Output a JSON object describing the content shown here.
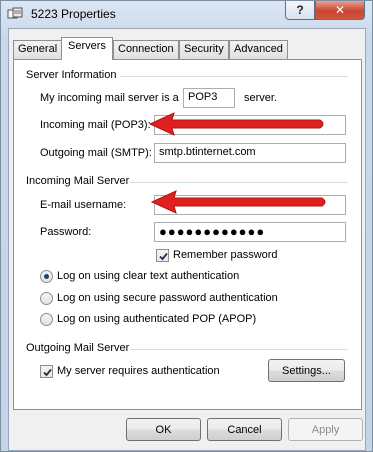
{
  "window": {
    "title": "5223 Properties",
    "help_label": "?",
    "close_label": "✕"
  },
  "tabs": [
    {
      "label": "General",
      "active": false
    },
    {
      "label": "Servers",
      "active": true
    },
    {
      "label": "Connection",
      "active": false
    },
    {
      "label": "Security",
      "active": false
    },
    {
      "label": "Advanced",
      "active": false
    }
  ],
  "server_info": {
    "group_label": "Server Information",
    "incoming_server_prefix": "My incoming mail server is a",
    "incoming_server_type": "POP3",
    "incoming_server_suffix": "server.",
    "incoming_mail_label": "Incoming mail (POP3):",
    "incoming_mail_value": "",
    "outgoing_mail_label": "Outgoing mail (SMTP):",
    "outgoing_mail_value": "smtp.btinternet.com"
  },
  "incoming_server": {
    "group_label": "Incoming Mail Server",
    "username_label": "E-mail username:",
    "username_value": "",
    "password_label": "Password:",
    "password_value": "●●●●●●●●●●●●",
    "remember_label": "Remember password",
    "remember_checked": true,
    "auth_options": [
      {
        "label": "Log on using clear text authentication",
        "selected": true
      },
      {
        "label": "Log on using secure password authentication",
        "selected": false
      },
      {
        "label": "Log on using authenticated POP (APOP)",
        "selected": false
      }
    ]
  },
  "outgoing_server": {
    "group_label": "Outgoing Mail Server",
    "requires_auth_label": "My server requires authentication",
    "requires_auth_checked": true,
    "settings_label": "Settings..."
  },
  "footer": {
    "ok_label": "OK",
    "cancel_label": "Cancel",
    "apply_label": "Apply"
  },
  "colors": {
    "annotation_arrow": "#e02020"
  }
}
